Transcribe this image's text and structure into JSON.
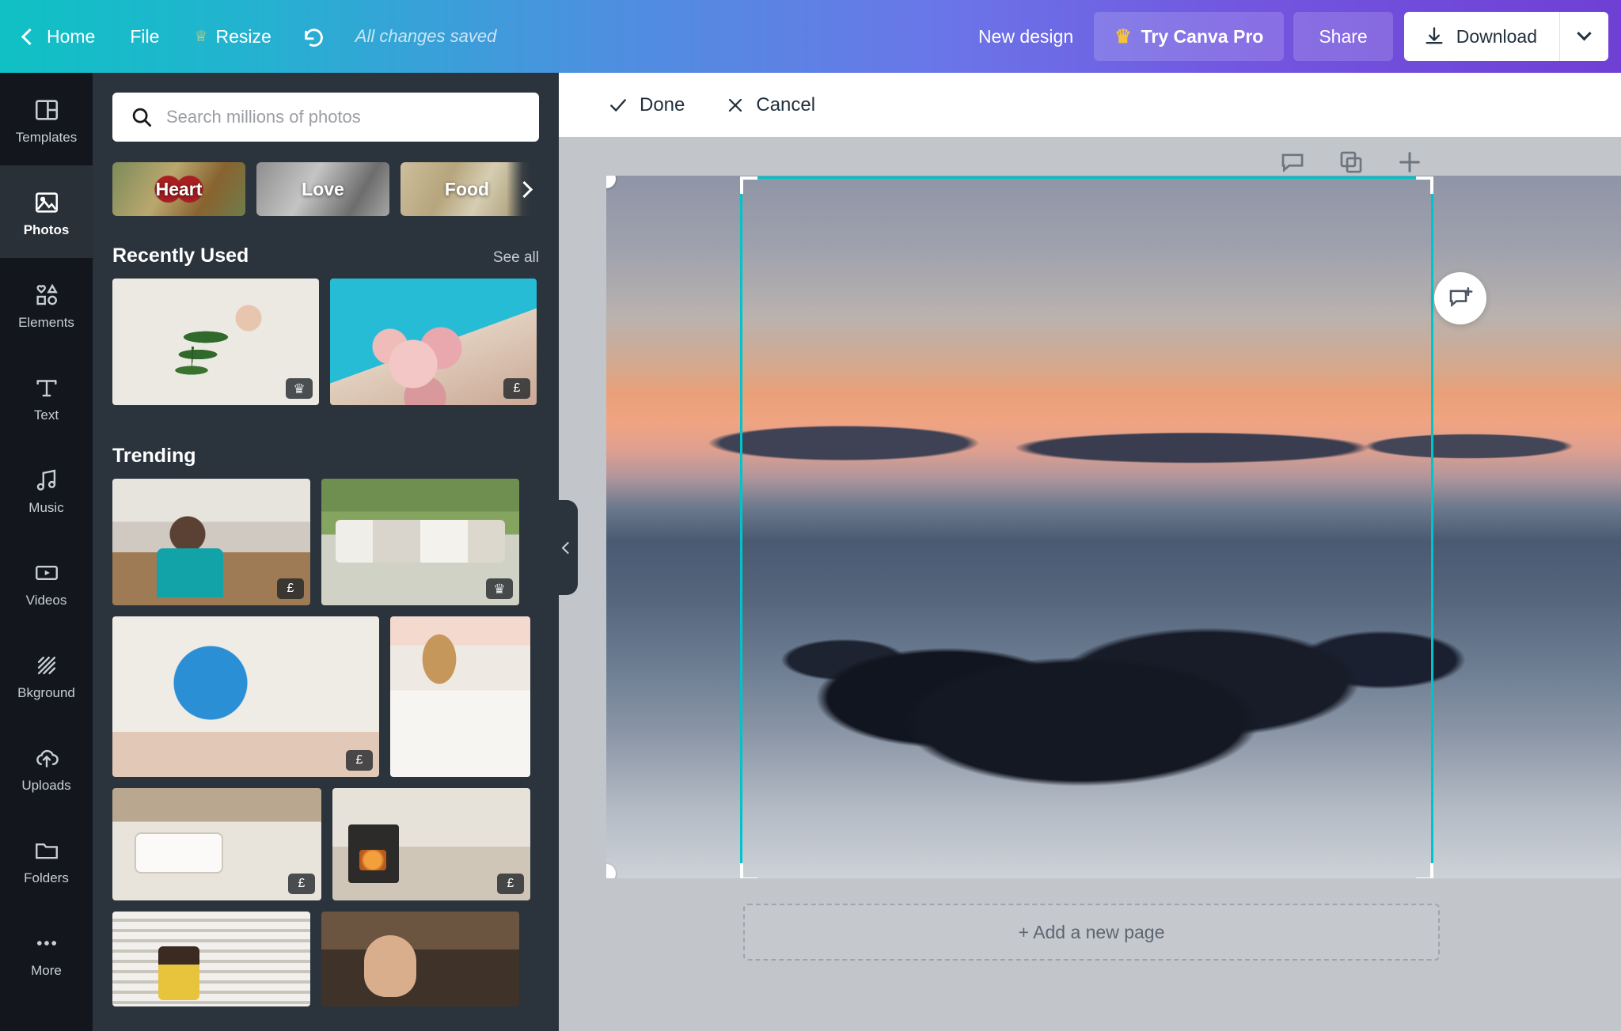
{
  "topbar": {
    "home": "Home",
    "file": "File",
    "resize": "Resize",
    "undo_icon": "undo-icon",
    "saved_status": "All changes saved",
    "new_design": "New design",
    "try_pro": "Try Canva Pro",
    "share": "Share",
    "download": "Download",
    "gradient_from": "#0fc1c4",
    "gradient_to": "#6f3fd4"
  },
  "rail": {
    "items": [
      {
        "label": "Templates",
        "icon": "templates-icon",
        "active": false
      },
      {
        "label": "Photos",
        "icon": "photos-icon",
        "active": true
      },
      {
        "label": "Elements",
        "icon": "elements-icon",
        "active": false
      },
      {
        "label": "Text",
        "icon": "text-icon",
        "active": false
      },
      {
        "label": "Music",
        "icon": "music-icon",
        "active": false
      },
      {
        "label": "Videos",
        "icon": "videos-icon",
        "active": false
      },
      {
        "label": "Bkground",
        "icon": "background-icon",
        "active": false
      },
      {
        "label": "Uploads",
        "icon": "uploads-icon",
        "active": false
      },
      {
        "label": "Folders",
        "icon": "folders-icon",
        "active": false
      },
      {
        "label": "More",
        "icon": "more-icon",
        "active": false
      }
    ]
  },
  "panel": {
    "search": {
      "placeholder": "Search millions of photos",
      "value": "",
      "icon": "search-icon"
    },
    "chips": [
      {
        "label": "Heart"
      },
      {
        "label": "Love"
      },
      {
        "label": "Food"
      }
    ],
    "chips_next_icon": "chevron-right-icon",
    "recently_used": {
      "title": "Recently Used",
      "see_all": "See all",
      "items": [
        {
          "name": "palm-leaf-photo",
          "badge": "crown"
        },
        {
          "name": "roses-woman-photo",
          "badge": "£"
        }
      ]
    },
    "trending": {
      "title": "Trending",
      "items": [
        {
          "name": "man-kitchen-photo",
          "badge": "£"
        },
        {
          "name": "friends-picnic-photo",
          "badge": "crown"
        },
        {
          "name": "hands-globe-photo",
          "badge": "£"
        },
        {
          "name": "woman-beige-photo",
          "badge": ""
        },
        {
          "name": "hands-sink-photo",
          "badge": "£"
        },
        {
          "name": "woman-fireplace-photo",
          "badge": "£"
        },
        {
          "name": "child-blinds-photo",
          "badge": ""
        },
        {
          "name": "bearded-man-photo",
          "badge": ""
        }
      ]
    }
  },
  "collapse_handle_icon": "chevron-left-icon",
  "canvas": {
    "done": "Done",
    "cancel": "Cancel",
    "done_icon": "check-icon",
    "cancel_icon": "close-icon",
    "page_tools": [
      "notes-icon",
      "duplicate-page-icon",
      "add-page-icon"
    ],
    "comment_icon": "add-comment-icon",
    "add_page": "+ Add a new page",
    "photo_name": "sunset-seascape-rocks-photo",
    "selection_color": "#00c4cc"
  }
}
